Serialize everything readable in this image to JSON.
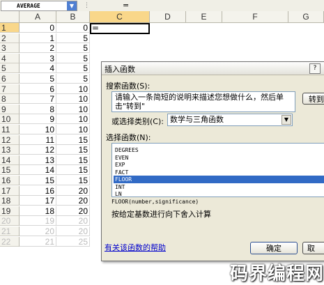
{
  "formula_bar": {
    "name_box": "AVERAGE",
    "name_box_arrow": "▼",
    "fx_divider": "⋮",
    "formula": "="
  },
  "columns": [
    "A",
    "B",
    "C",
    "D",
    "E",
    "F",
    "G"
  ],
  "rows": [
    {
      "n": "1",
      "a": "0",
      "b": "0"
    },
    {
      "n": "2",
      "a": "1",
      "b": "5"
    },
    {
      "n": "3",
      "a": "2",
      "b": "5"
    },
    {
      "n": "4",
      "a": "3",
      "b": "5"
    },
    {
      "n": "5",
      "a": "4",
      "b": "5"
    },
    {
      "n": "6",
      "a": "5",
      "b": "5"
    },
    {
      "n": "7",
      "a": "6",
      "b": "10"
    },
    {
      "n": "8",
      "a": "7",
      "b": "10"
    },
    {
      "n": "9",
      "a": "8",
      "b": "10"
    },
    {
      "n": "10",
      "a": "9",
      "b": "10"
    },
    {
      "n": "11",
      "a": "10",
      "b": "10"
    },
    {
      "n": "12",
      "a": "11",
      "b": "15"
    },
    {
      "n": "13",
      "a": "12",
      "b": "15"
    },
    {
      "n": "14",
      "a": "13",
      "b": "15"
    },
    {
      "n": "15",
      "a": "14",
      "b": "15"
    },
    {
      "n": "16",
      "a": "15",
      "b": "15"
    },
    {
      "n": "17",
      "a": "16",
      "b": "20"
    },
    {
      "n": "18",
      "a": "17",
      "b": "20"
    },
    {
      "n": "19",
      "a": "18",
      "b": "20"
    },
    {
      "n": "20",
      "a": "19",
      "b": "20"
    },
    {
      "n": "21",
      "a": "20",
      "b": "20"
    },
    {
      "n": "22",
      "a": "21",
      "b": "25"
    }
  ],
  "active_cell": {
    "column": "C",
    "row": "1",
    "content": "="
  },
  "dialog": {
    "title": "插入函数",
    "help_button": "?",
    "search_label": "搜索函数(S):",
    "search_text": "请输入一条简短的说明来描述您想做什么，然后单击\"转到\"",
    "goto_button": "转到",
    "category_label": "或选择类别(C):",
    "category_value": "数学与三角函数",
    "category_arrow": "▼",
    "function_label": "选择函数(N):",
    "functions": [
      "DEGREES",
      "EVEN",
      "EXP",
      "FACT",
      "FLOOR",
      "INT",
      "LN"
    ],
    "selected_function": "FLOOR",
    "syntax": "FLOOR(number,significance)",
    "description": "按给定基数进行向下舍入计算",
    "help_link": "有关该函数的帮助",
    "ok_button": "确定",
    "cancel_button": "取"
  },
  "watermark": "码界编程网",
  "colors": {
    "selection_header": "#f9d78a",
    "selected_list_item": "#316ac5",
    "dialog_background": "#ece9d8",
    "link": "#0000cc"
  }
}
